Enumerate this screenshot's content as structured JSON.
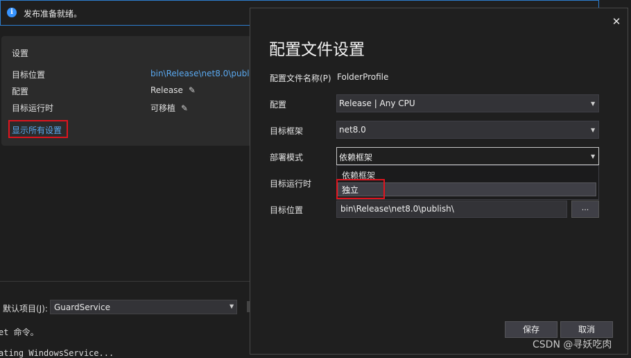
{
  "info_bar": {
    "message": "发布准备就绪。",
    "icon": "info-icon"
  },
  "settings": {
    "title": "设置",
    "rows": [
      {
        "label": "目标位置",
        "value": "bin\\Release\\net8.0\\publi"
      },
      {
        "label": "配置",
        "value": "Release"
      },
      {
        "label": "目标运行时",
        "value": "可移植"
      }
    ],
    "show_all": "显示所有设置"
  },
  "bottom_panel": {
    "default_project_label": "默认项目(J):",
    "default_project_value": "GuardService",
    "output_line1": "et 命令。",
    "output_line2": "ating WindowsService..."
  },
  "dialog": {
    "title": "配置文件设置",
    "close": "✕",
    "profile_name_label": "配置文件名称(P)",
    "profile_name_value": "FolderProfile",
    "config_label": "配置",
    "config_value": "Release | Any CPU",
    "framework_label": "目标框架",
    "framework_value": "net8.0",
    "deploy_label": "部署模式",
    "deploy_value": "依赖框架",
    "deploy_options": [
      "依赖框架",
      "独立"
    ],
    "runtime_label": "目标运行时",
    "location_label": "目标位置",
    "location_value": "bin\\Release\\net8.0\\publish\\",
    "browse": "...",
    "save": "保存",
    "cancel": "取消"
  },
  "watermark": "CSDN @寻妖吃肉",
  "colors": {
    "accent": "#3794ff",
    "highlight_box": "#e0141e",
    "link": "#5aa9f0"
  }
}
